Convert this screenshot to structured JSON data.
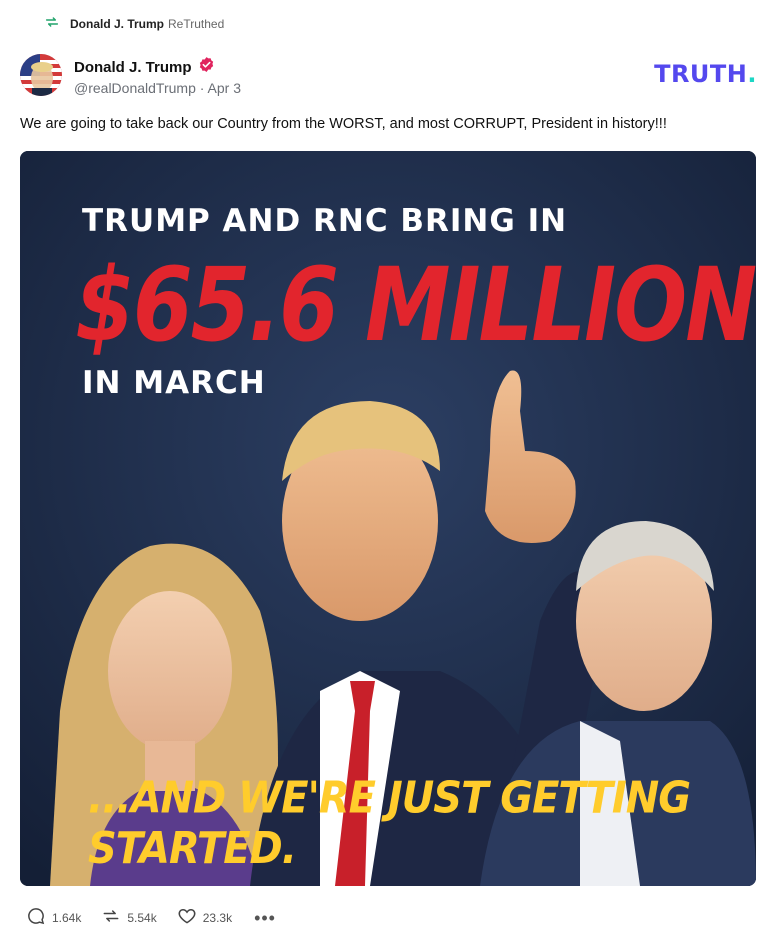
{
  "retruth": {
    "name": "Donald J. Trump",
    "verb": "ReTruthed"
  },
  "author": {
    "display_name": "Donald J. Trump",
    "handle": "@realDonaldTrump",
    "separator": "·",
    "date": "Apr 3",
    "verified": true
  },
  "logo": {
    "text": "TRUTH",
    "dot": "."
  },
  "post": {
    "text": "We are going to take back our Country from the WORST, and most CORRUPT, President in history!!!"
  },
  "media": {
    "line1": "TRUMP AND RNC BRING IN",
    "amount": "$65.6 MILLION",
    "line3": "IN MARCH",
    "bottom": "...AND WE'RE JUST GETTING STARTED."
  },
  "actions": {
    "replies": "1.64k",
    "retruths": "5.54k",
    "likes": "23.3k",
    "more": "•••"
  },
  "colors": {
    "brand_purple": "#5448ee",
    "brand_teal": "#1dd7c5",
    "retruth_green": "#21a36b",
    "verified_red": "#e0245e",
    "headline_red": "#e2252d",
    "headline_yellow": "#ffcc2c"
  },
  "icons": {
    "retruth": "retruth-icon",
    "verified": "verified-badge-icon",
    "reply": "reply-icon",
    "repost": "retruth-icon",
    "like": "heart-icon",
    "more": "more-icon"
  }
}
